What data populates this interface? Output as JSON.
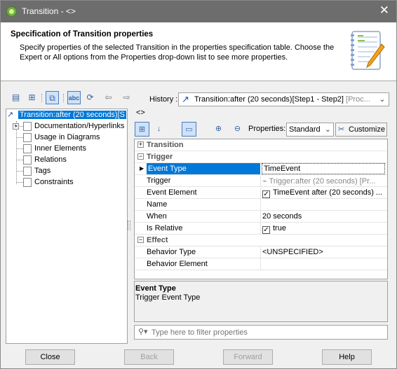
{
  "window": {
    "title": "Transition - <>",
    "close_glyph": "✕"
  },
  "header": {
    "title": "Specification of Transition properties",
    "description": "Specify properties of the selected Transition in the properties specification table. Choose the Expert or All options from the Properties drop-down list to see more properties."
  },
  "history": {
    "label": "History :",
    "value": "Transition:after (20 seconds)[Step1 - Step2]",
    "value_more": " [Proc..."
  },
  "tree": {
    "root": "Transition:after (20 seconds)[S",
    "items": [
      "Documentation/Hyperlinks",
      "Usage in Diagrams",
      "Inner Elements",
      "Relations",
      "Tags",
      "Constraints"
    ]
  },
  "panel": {
    "crumb": "<>",
    "properties_label": "Properties:",
    "properties_value": "Standard",
    "customize_label": "Customize"
  },
  "grid": {
    "groups": {
      "transition": "Transition",
      "trigger": "Trigger",
      "effect": "Effect"
    },
    "rows": [
      {
        "name": "Event Type",
        "value": "TimeEvent"
      },
      {
        "name": "Trigger",
        "value": "Trigger:after (20 seconds) [Pr..."
      },
      {
        "name": "Event Element",
        "value": "TimeEvent after (20 seconds) ..."
      },
      {
        "name": "Name",
        "value": ""
      },
      {
        "name": "When",
        "value": "20 seconds"
      },
      {
        "name": "Is Relative",
        "value": "true"
      },
      {
        "name": "Behavior Type",
        "value": "<UNSPECIFIED>"
      },
      {
        "name": "Behavior Element",
        "value": ""
      }
    ]
  },
  "description": {
    "title": "Event Type",
    "text": "Trigger Event Type"
  },
  "filter": {
    "placeholder": "Type here to filter properties"
  },
  "buttons": {
    "close": "Close",
    "back": "Back",
    "forward": "Forward",
    "help": "Help"
  }
}
